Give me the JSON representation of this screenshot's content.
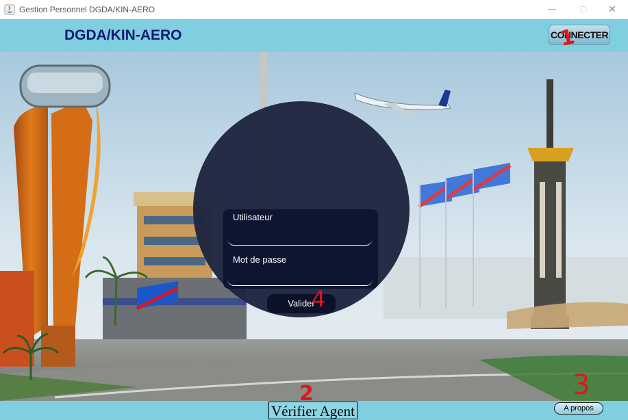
{
  "window": {
    "title": "Gestion Personnel DGDA/KIN-AERO",
    "minimize": "—",
    "maximize": "☐",
    "close": "✕"
  },
  "header": {
    "brand": "DGDA/KIN-AERO",
    "connect_label": "CONNECTER"
  },
  "login": {
    "user_label": "Utilisateur",
    "user_value": "",
    "password_label": "Mot de passe",
    "password_value": "",
    "validate_label": "Valider"
  },
  "footer": {
    "verify_label": "Vérifier Agent",
    "about_label": "A propos"
  },
  "annotations": [
    "1",
    "2",
    "3",
    "4"
  ],
  "colors": {
    "header_bg": "#7fcfe0",
    "brand": "#151a72",
    "panel": "#0e1530",
    "circle": "#1f2640",
    "annotation": "#e3141b"
  }
}
